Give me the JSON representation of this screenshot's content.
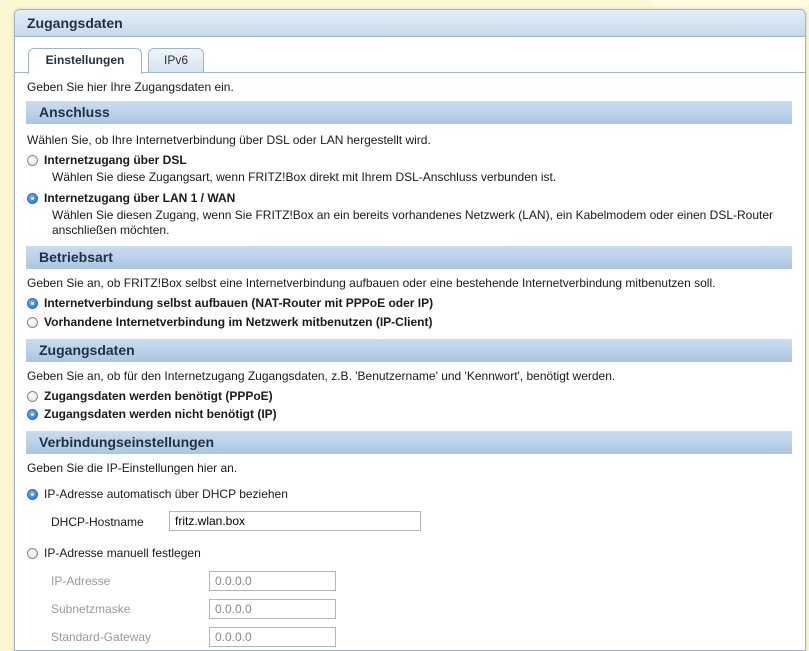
{
  "panel": {
    "title": "Zugangsdaten"
  },
  "tabs": [
    {
      "label": "Einstellungen",
      "active": true
    },
    {
      "label": "IPv6",
      "active": false
    }
  ],
  "intro": "Geben Sie hier Ihre Zugangsdaten ein.",
  "anschluss": {
    "title": "Anschluss",
    "text": "Wählen Sie, ob Ihre Internetverbindung über DSL oder LAN hergestellt wird.",
    "options": [
      {
        "label": "Internetzugang über DSL",
        "checked": false,
        "desc": "Wählen Sie diese Zugangsart, wenn FRITZ!Box direkt mit Ihrem DSL-Anschluss verbunden ist."
      },
      {
        "label": "Internetzugang über LAN 1 / WAN",
        "checked": true,
        "desc": "Wählen Sie diesen Zugang, wenn Sie FRITZ!Box an ein bereits vorhandenes Netzwerk (LAN), ein Kabelmodem oder einen DSL-Router anschließen möchten."
      }
    ]
  },
  "betriebsart": {
    "title": "Betriebsart",
    "text": "Geben Sie an, ob FRITZ!Box selbst eine Internetverbindung aufbauen oder eine bestehende Internetverbindung mitbenutzen soll.",
    "options": [
      {
        "label": "Internetverbindung selbst aufbauen (NAT-Router mit PPPoE oder IP)",
        "checked": true
      },
      {
        "label": "Vorhandene Internetverbindung im Netzwerk mitbenutzen (IP-Client)",
        "checked": false
      }
    ]
  },
  "zugangsdaten": {
    "title": "Zugangsdaten",
    "text": "Geben Sie an, ob für den Internetzugang Zugangsdaten, z.B. 'Benutzername' und 'Kennwort', benötigt werden.",
    "options": [
      {
        "label": "Zugangsdaten werden benötigt (PPPoE)",
        "checked": false
      },
      {
        "label": "Zugangsdaten werden nicht benötigt (IP)",
        "checked": true
      }
    ]
  },
  "verbindung": {
    "title": "Verbindungseinstellungen",
    "text": "Geben Sie die IP-Einstellungen hier an.",
    "dhcp_option": {
      "label": "IP-Adresse automatisch über DHCP beziehen",
      "checked": true
    },
    "hostname_label": "DHCP-Hostname",
    "hostname_value": "fritz.wlan.box",
    "manual_option": {
      "label": "IP-Adresse manuell festlegen",
      "checked": false
    },
    "ip_label": "IP-Adresse",
    "ip_value": "0.0.0.0",
    "subnet_label": "Subnetzmaske",
    "subnet_value": "0.0.0.0",
    "gateway_label": "Standard-Gateway",
    "gateway_value": "0.0.0.0"
  }
}
